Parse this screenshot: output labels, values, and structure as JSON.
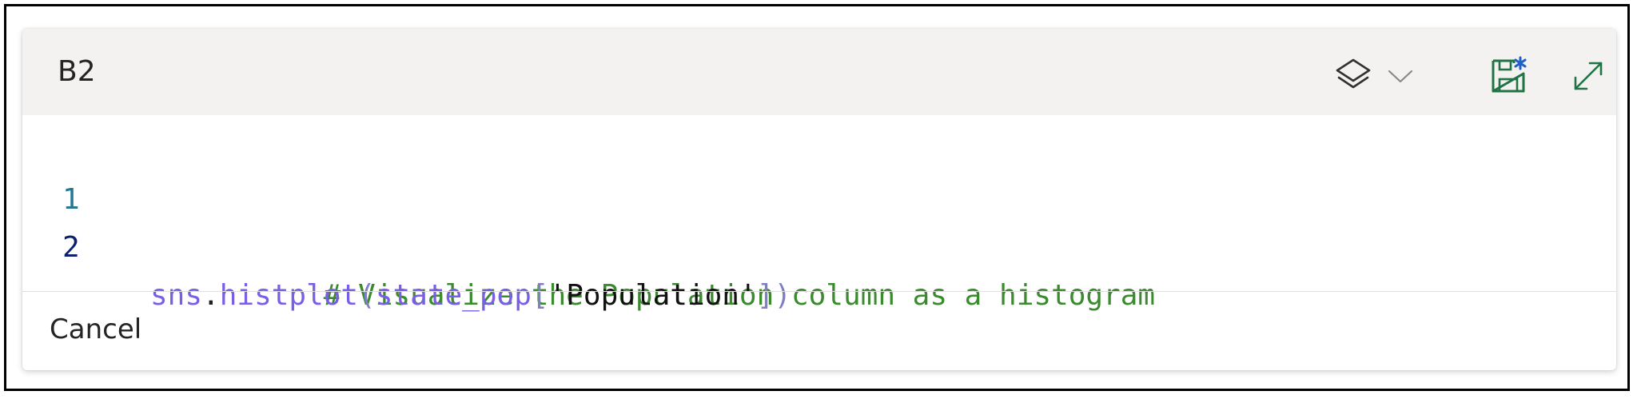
{
  "editor": {
    "cell_reference": "B2",
    "toolbar": {
      "icons": [
        "layers-icon",
        "chevron-down-icon",
        "save-icon",
        "expand-icon"
      ],
      "icon_color": "#217346",
      "layers_icon_color": "#323130"
    },
    "code_lines": [
      {
        "number": "1",
        "tokens": [
          {
            "type": "comment",
            "text": "# Visualize the Population column as a histogram"
          }
        ]
      },
      {
        "number": "2",
        "tokens": [
          {
            "type": "ident",
            "text": "sns"
          },
          {
            "type": "punct",
            "text": "."
          },
          {
            "type": "ident",
            "text": "histplot"
          },
          {
            "type": "bracket",
            "text": "("
          },
          {
            "type": "ident",
            "text": "state_pop"
          },
          {
            "type": "bracket",
            "text": "["
          },
          {
            "type": "string",
            "text": "'Population'"
          },
          {
            "type": "bracket",
            "text": "])"
          }
        ]
      }
    ],
    "footer": {
      "cancel_label": "Cancel"
    }
  },
  "colors": {
    "header_bg": "#f3f2f1",
    "comment": "#3a8a2e",
    "identifier": "#795ee6",
    "bracket": "#7f7fc5",
    "string": "#111111",
    "line_number_1": "#237893",
    "line_number_2": "#0b216f"
  }
}
